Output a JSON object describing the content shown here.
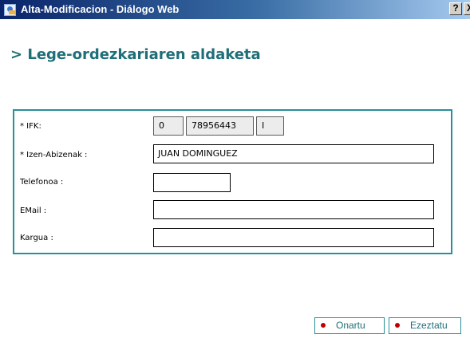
{
  "window": {
    "title": "Alta-Modificacion - Diálogo Web",
    "help_label": "?",
    "close_label": "X"
  },
  "page": {
    "title": "> Lege-ordezkariaren aldaketa"
  },
  "form": {
    "ifk": {
      "label": "* IFK:",
      "part1": "0",
      "part2": "78956443",
      "part3": "I"
    },
    "name": {
      "label": "* Izen-Abizenak :",
      "value": "JUAN DOMINGUEZ"
    },
    "phone": {
      "label": "Telefonoa :",
      "value": ""
    },
    "email": {
      "label": "EMail :",
      "value": ""
    },
    "position": {
      "label": "Kargua :",
      "value": ""
    }
  },
  "buttons": {
    "accept": "Onartu",
    "cancel": "Ezeztatu"
  }
}
